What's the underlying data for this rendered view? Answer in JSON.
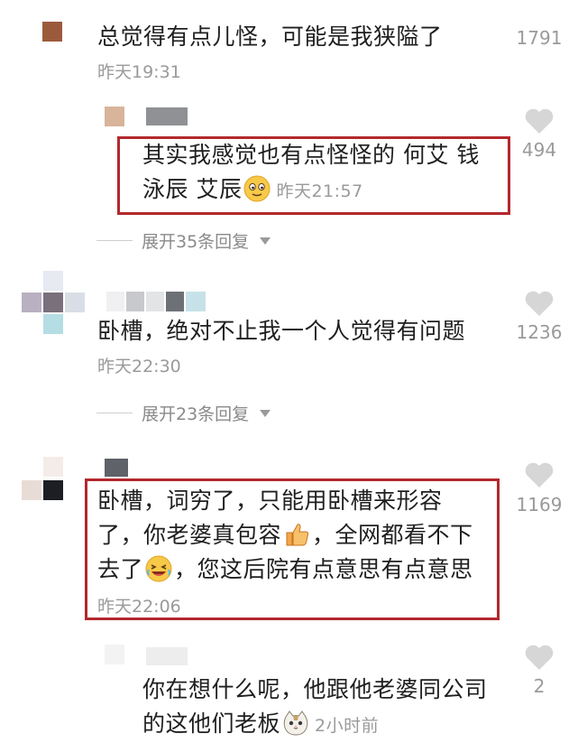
{
  "comments": [
    {
      "text": "总觉得有点儿怪，可能是我狭隘了",
      "time": "昨天19:31",
      "likes": "1791"
    },
    {
      "text": "其实我感觉也有点怪怪的 何艾 钱",
      "text2": "泳辰 艾辰",
      "time": "昨天21:57",
      "likes": "494",
      "emoji": "smiling-face-emoji"
    },
    {
      "text": "卧槽，绝对不止我一个人觉得有问题",
      "time": "昨天22:30",
      "likes": "1236"
    },
    {
      "line1": "卧槽，词穷了，只能用卧槽来形容",
      "line2a": "了，你老婆真包容",
      "line2b": "，全网都看不下",
      "line3a": "去了",
      "line3b": "，您这后院有点意思有点意思",
      "time": "昨天22:06",
      "likes": "1169",
      "emojis": [
        "thumbs-up-emoji",
        "laughing-face-emoji"
      ]
    },
    {
      "line1": "你在想什么呢，他跟他老婆同公司",
      "line2": "的这他们老板",
      "time": "2小时前",
      "likes": "2",
      "emoji": "cat-face-emoji"
    }
  ],
  "expand_labels": [
    "展开35条回复",
    "展开23条回复"
  ],
  "colors": {
    "highlight_border": "#b3282d",
    "meta_gray": "#9a9a9a",
    "text": "#1f1f1f"
  },
  "icons": [
    "heart-icon",
    "chevron-down-icon"
  ]
}
